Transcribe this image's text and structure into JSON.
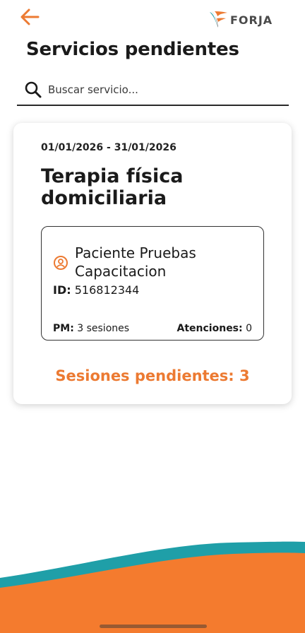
{
  "header": {
    "back_icon": "arrow-left-icon",
    "logo_icon": "forja-logo-icon",
    "logo_text": "FORJA",
    "title": "Servicios pendientes"
  },
  "search": {
    "icon": "search-icon",
    "placeholder": "Buscar servicio..."
  },
  "service_card": {
    "date_range": "01/01/2026 - 31/01/2026",
    "title": "Terapia física domiciliaria",
    "patient": {
      "icon": "person-circle-icon",
      "name": "Paciente Pruebas Capacitacion",
      "id_label": "ID:",
      "id_value": "516812344",
      "pm_label": "PM:",
      "pm_value": "3 sesiones",
      "atenciones_label": "Atenciones:",
      "atenciones_value": "0"
    },
    "pending_sessions": "Sesiones pendientes: 3"
  },
  "colors": {
    "accent_orange": "#ec7a32",
    "wave_teal": "#1f9fa8",
    "wave_orange": "#f47b2e"
  }
}
